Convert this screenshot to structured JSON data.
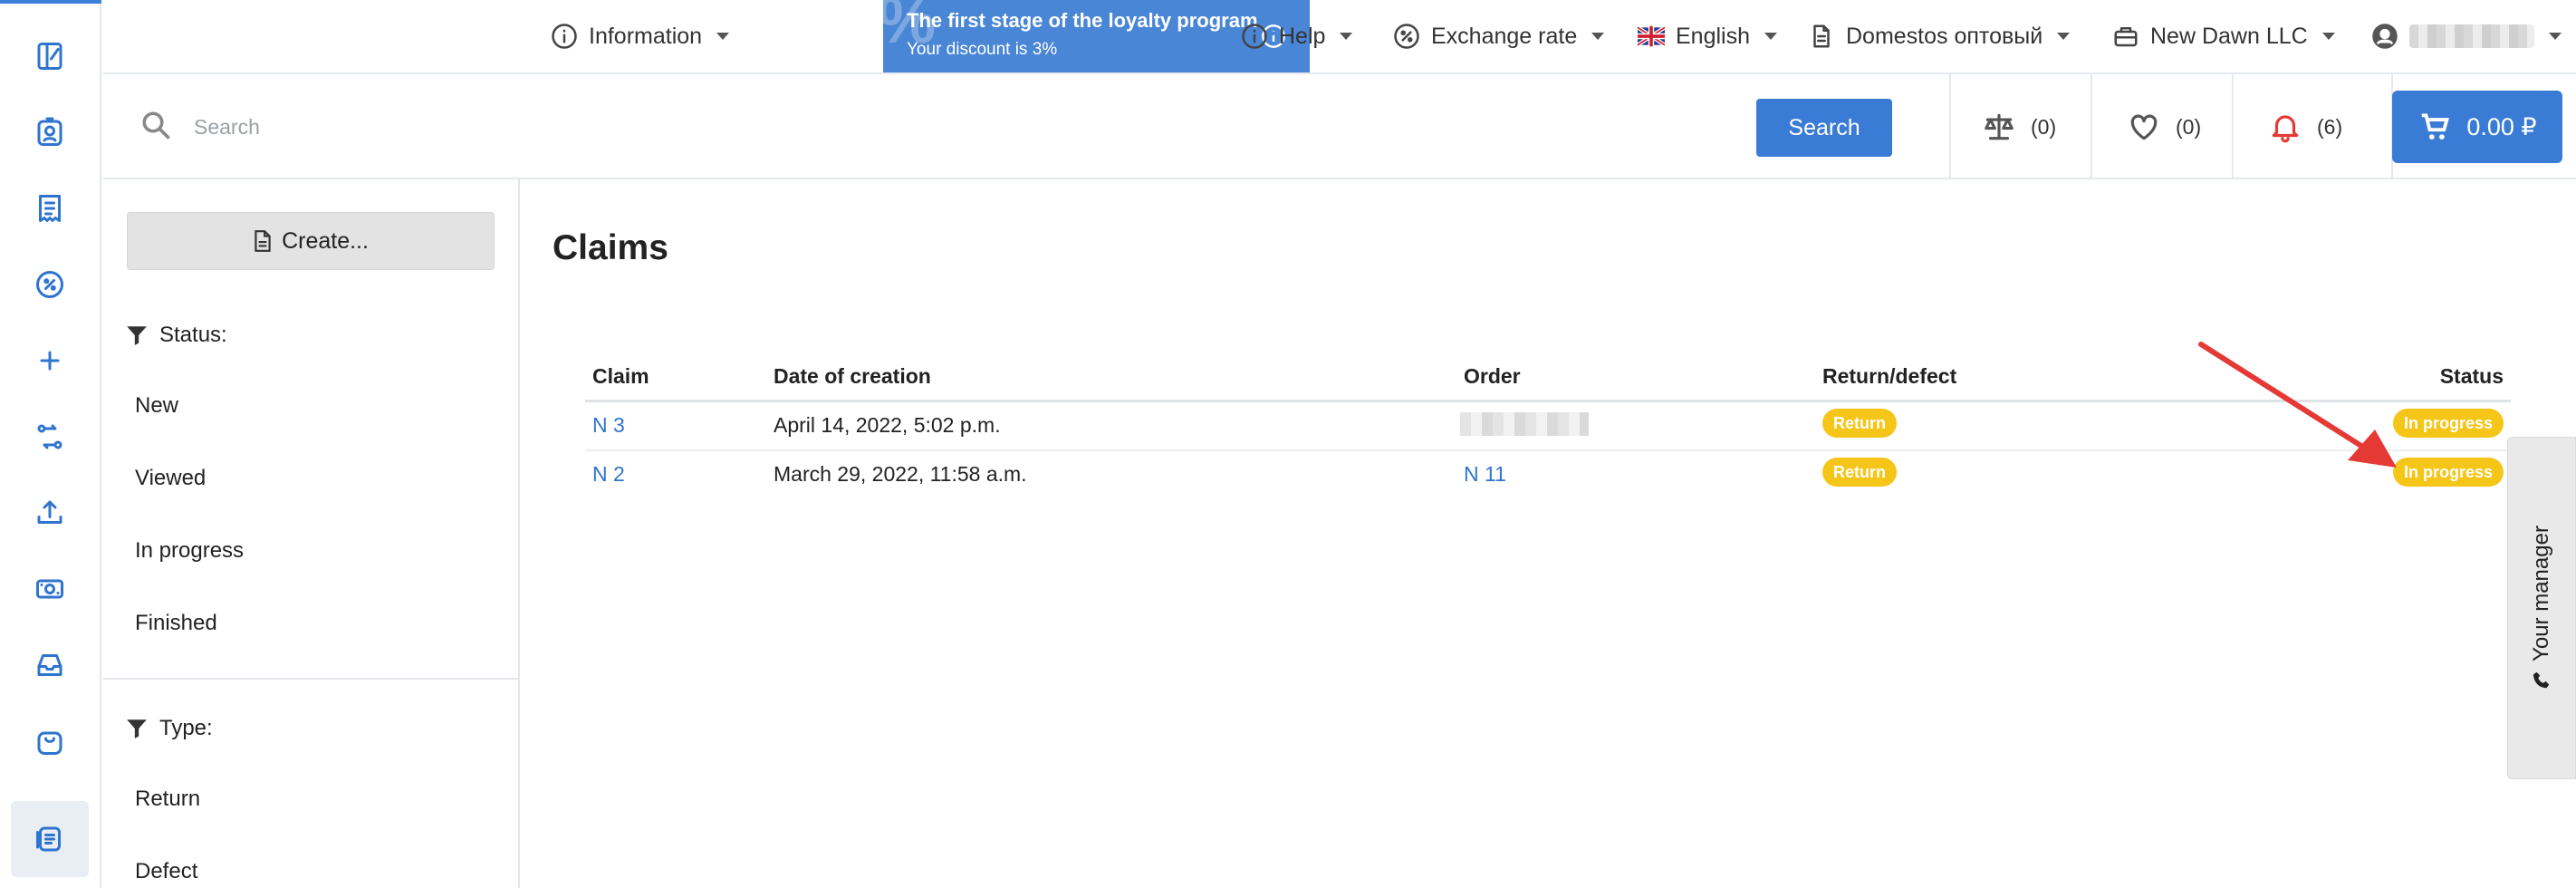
{
  "topbar": {
    "information": "Information",
    "loyalty_title": "The first stage of the loyalty program",
    "loyalty_discount": "Your discount is 3%",
    "loyalty_symbol": "%",
    "help": "Help",
    "exchange_rate": "Exchange rate",
    "language": "English",
    "warehouse": "Domestos оптовый",
    "company": "New Dawn LLC"
  },
  "search": {
    "placeholder": "Search",
    "button": "Search"
  },
  "counters": {
    "compare": "(0)",
    "favorites": "(0)",
    "notifications": "(6)",
    "cart_total": "0.00 ₽"
  },
  "sidebar": {
    "create_label": "Create...",
    "status_heading": "Status:",
    "status_items": [
      "New",
      "Viewed",
      "In progress",
      "Finished"
    ],
    "type_heading": "Type:",
    "type_items": [
      "Return",
      "Defect"
    ]
  },
  "main": {
    "title": "Claims",
    "columns": [
      "Claim",
      "Date of creation",
      "Order",
      "Return/defect",
      "Status"
    ],
    "rows": [
      {
        "claim": "N 3",
        "date": "April 14, 2022, 5:02 p.m.",
        "order": "",
        "type": "Return",
        "status": "In progress"
      },
      {
        "claim": "N 2",
        "date": "March 29, 2022, 11:58 a.m.",
        "order": "N 11",
        "type": "Return",
        "status": "In progress"
      }
    ]
  },
  "manager_tab": {
    "label": "Your manager"
  },
  "colors": {
    "accent": "#3a7bd5",
    "badge": "#f5c518",
    "annotation_arrow": "#e53935",
    "notification_bell": "#e53935"
  }
}
